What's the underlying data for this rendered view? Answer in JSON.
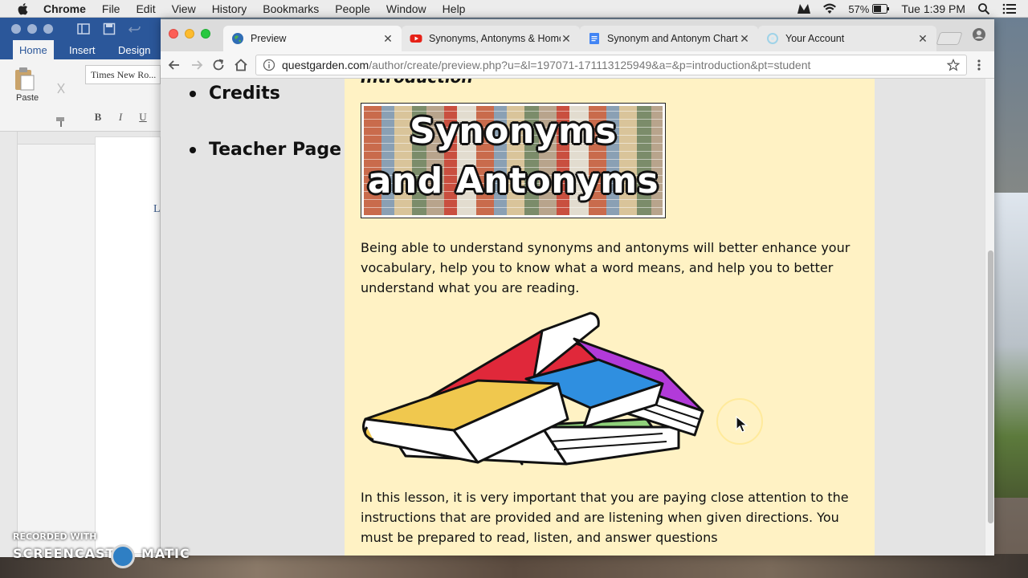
{
  "menubar": {
    "app_name": "Chrome",
    "items": [
      "File",
      "Edit",
      "View",
      "History",
      "Bookmarks",
      "People",
      "Window",
      "Help"
    ],
    "battery": "57%",
    "clock": "Tue 1:39 PM"
  },
  "word": {
    "tabs": [
      "Home",
      "Insert",
      "Design"
    ],
    "font_name": "Times New Ro...",
    "paste_label": "Paste",
    "format_buttons": [
      "B",
      "I",
      "U"
    ],
    "page_letter": "L"
  },
  "chrome": {
    "tabs": [
      {
        "title": "Preview",
        "active": true,
        "icon": "globe-icon"
      },
      {
        "title": "Synonyms, Antonyms & Homophones",
        "active": false,
        "icon": "youtube-icon"
      },
      {
        "title": "Synonym and Antonym Chart",
        "active": false,
        "icon": "docs-icon"
      },
      {
        "title": "Your Account",
        "active": false,
        "icon": "loading-icon"
      }
    ],
    "url_host": "questgarden.com",
    "url_path": "/author/create/preview.php?u=&l=197071-171113125949&a=&p=introduction&pt=student"
  },
  "page": {
    "nav": [
      "Credits",
      "Teacher Page"
    ],
    "section_heading": "Introduction",
    "banner_line1": "Synonyms",
    "banner_line2": "and Antonyms",
    "para1": "Being able to understand synonyms and antonyms will better enhance your vocabulary, help you to know what a word means, and help you to better understand what you are reading.",
    "para2": "In this lesson, it is very important that you are paying close attention to the instructions that are provided and are listening when given directions. You must be prepared to read, listen, and answer questions"
  },
  "watermark": {
    "small": "RECORDED WITH",
    "big_left": "SCREENCAST",
    "big_right": "MATIC"
  },
  "colors": {
    "content_bg": "#fff2c4",
    "chrome_tab_strip": "#dcdcdc",
    "word_blue": "#2b579a"
  }
}
